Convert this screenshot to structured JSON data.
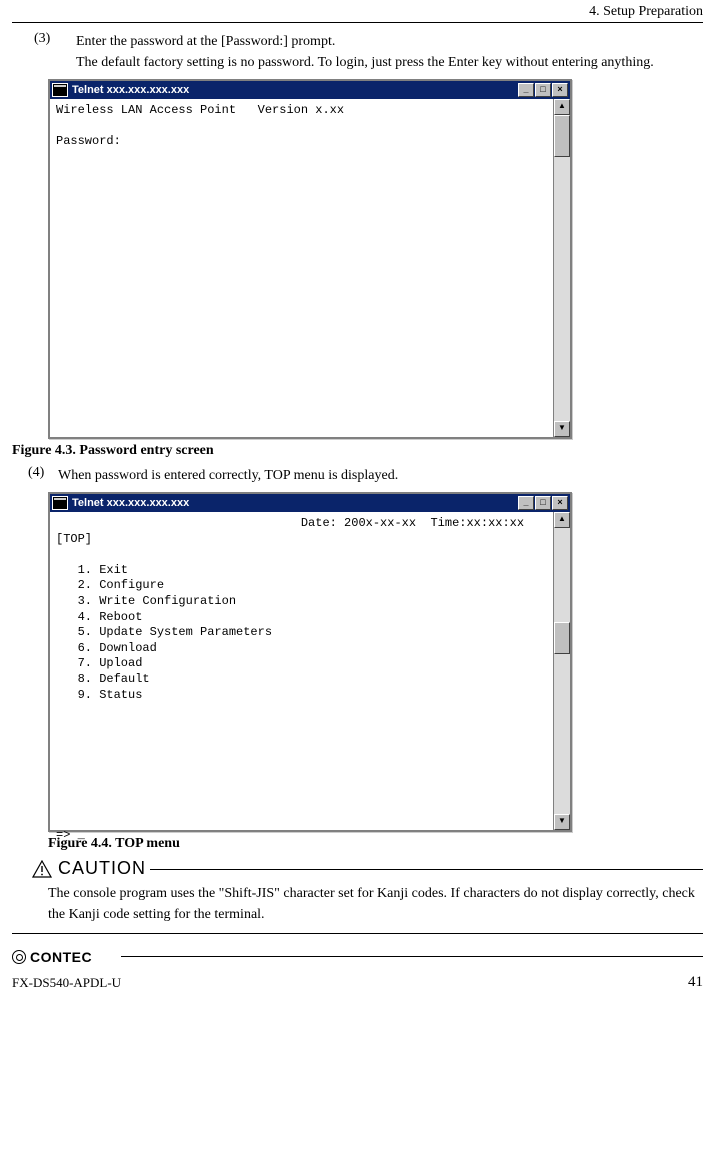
{
  "header": {
    "section": "4. Setup Preparation"
  },
  "step3": {
    "num": "(3)",
    "line1": "Enter the password at the [Password:] prompt.",
    "line2": "The default factory setting is no password.  To login, just press the Enter key without entering anything."
  },
  "telnet1": {
    "title": "Telnet xxx.xxx.xxx.xxx",
    "content": "Wireless LAN Access Point   Version x.xx\n\nPassword:"
  },
  "fig43": "Figure 4.3.  Password entry screen",
  "step4": {
    "num": "(4)",
    "text": "When password is entered correctly, TOP menu is displayed."
  },
  "telnet2": {
    "title": "Telnet xxx.xxx.xxx.xxx",
    "content": "                                  Date: 200x-xx-xx  Time:xx:xx:xx\n[TOP]\n\n   1. Exit\n   2. Configure\n   3. Write Configuration\n   4. Reboot\n   5. Update System Parameters\n   6. Download\n   7. Upload\n   8. Default\n   9. Status\n\n\n\n\n\n\n\n\n=> _"
  },
  "fig44": "Figure 4.4.  TOP menu",
  "caution": {
    "label": "CAUTION",
    "text": "The console program uses the \"Shift-JIS\" character set for Kanji codes.  If characters do not display correctly, check the Kanji code setting for the terminal."
  },
  "footer": {
    "brand": "CONTEC",
    "model": "FX-DS540-APDL-U",
    "page": "41"
  },
  "winbtn": {
    "min": "_",
    "max": "□",
    "close": "×",
    "up": "▲",
    "down": "▼"
  }
}
